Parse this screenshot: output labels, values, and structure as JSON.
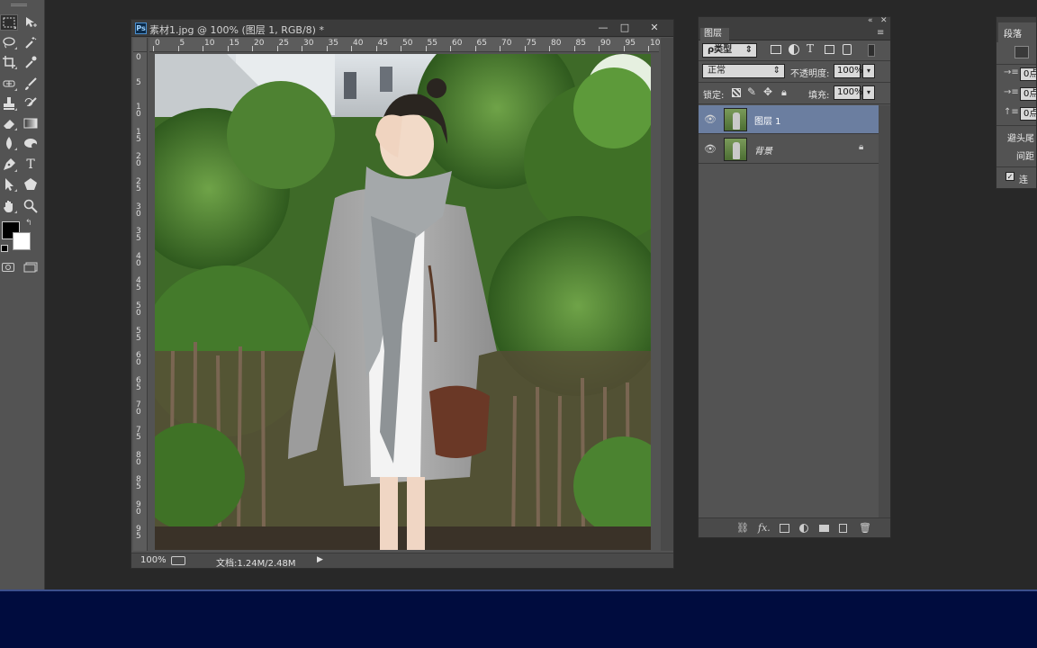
{
  "document": {
    "title": "素材1.jpg @ 100% (图层 1, RGB/8) *",
    "ps_badge": "Ps",
    "zoom": "100%",
    "doc_info": "文档:1.24M/2.48M",
    "ruler_h": [
      "0",
      "5",
      "10",
      "15",
      "20",
      "25",
      "30",
      "35",
      "40",
      "45",
      "50",
      "55",
      "60",
      "65",
      "70",
      "75",
      "80",
      "85",
      "90",
      "95",
      "10"
    ],
    "ruler_v": [
      "0",
      "5",
      "10",
      "15",
      "20",
      "25",
      "30",
      "35",
      "40",
      "45",
      "50",
      "55",
      "60",
      "65",
      "70",
      "75",
      "80",
      "85",
      "90",
      "95"
    ]
  },
  "window_buttons": {
    "minimize": "—",
    "maximize": "□",
    "close": "✕"
  },
  "layers_panel": {
    "tab": "图层",
    "filter": "ρ类型",
    "blend_mode": "正常",
    "opacity_label": "不透明度:",
    "opacity_value": "100%",
    "lock_label": "锁定:",
    "fill_label": "填充:",
    "fill_value": "100%",
    "layers": [
      {
        "name": "图层 1",
        "selected": true,
        "locked": false
      },
      {
        "name": "背景",
        "selected": false,
        "locked": true
      }
    ],
    "footer_icons": [
      "link-icon",
      "fx-icon",
      "mask-icon",
      "adjustment-icon",
      "folder-icon",
      "new-layer-icon",
      "trash-icon"
    ],
    "footer_fx": "fx."
  },
  "paragraph_panel": {
    "tab": "段落",
    "indent_values": [
      "0点",
      "0点",
      "0点"
    ],
    "avoid_label": "避头尾",
    "spacing_label": "间距",
    "hyphenate_label": "连字"
  },
  "toolbox": {
    "tools": [
      "marquee-tool",
      "move-tool",
      "lasso-tool",
      "magic-wand-tool",
      "crop-tool",
      "eyedropper-tool",
      "healing-tool",
      "brush-tool",
      "stamp-tool",
      "history-brush-tool",
      "eraser-tool",
      "gradient-tool",
      "blur-tool",
      "dodge-tool",
      "pen-tool",
      "type-tool",
      "path-select-tool",
      "shape-tool",
      "hand-tool",
      "zoom-tool"
    ],
    "type_glyph": "T"
  },
  "colors": {
    "workspace": "#282828",
    "panel": "#535353",
    "selected_layer": "#6b7ea0",
    "taskbar": "#000c3e",
    "foreground": "#000000",
    "background": "#ffffff"
  }
}
